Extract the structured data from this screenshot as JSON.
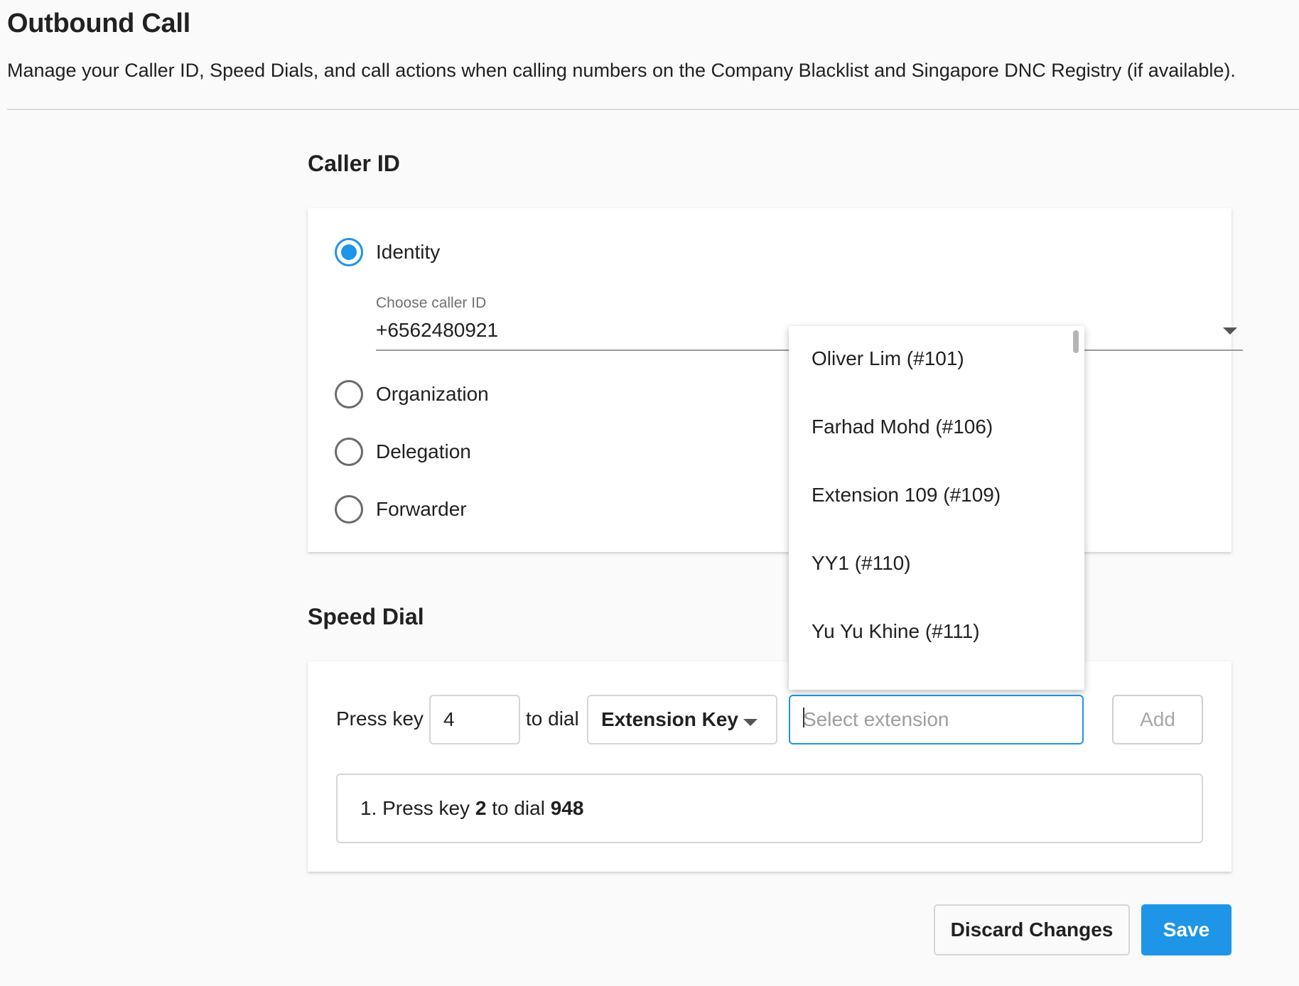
{
  "page": {
    "title": "Outbound Call",
    "description": "Manage your Caller ID, Speed Dials, and call actions when calling numbers on the Company Blacklist and Singapore DNC Registry (if available)."
  },
  "caller_id": {
    "section_title": "Caller ID",
    "options": [
      {
        "label": "Identity",
        "checked": true
      },
      {
        "label": "Organization",
        "checked": false
      },
      {
        "label": "Delegation",
        "checked": false
      },
      {
        "label": "Forwarder",
        "checked": false
      }
    ],
    "field_label": "Choose caller ID",
    "field_value": "+6562480921"
  },
  "speed_dial": {
    "section_title": "Speed Dial",
    "press_key_label": "Press key",
    "key_value": "4",
    "to_dial_label": "to dial",
    "type_select_value": "Extension Key",
    "extension_placeholder": "Select extension",
    "add_label": "Add",
    "entries": [
      {
        "prefix": "1. Press key ",
        "key": "2",
        "middle": " to dial ",
        "target": "948"
      }
    ]
  },
  "extension_dropdown": {
    "items": [
      "Oliver Lim (#101)",
      "Farhad Mohd (#106)",
      "Extension 109 (#109)",
      "YY1 (#110)",
      "Yu Yu Khine (#111)"
    ]
  },
  "footer": {
    "discard_label": "Discard Changes",
    "save_label": "Save"
  },
  "colors": {
    "accent": "#1e95e6",
    "background": "#fafafa"
  }
}
